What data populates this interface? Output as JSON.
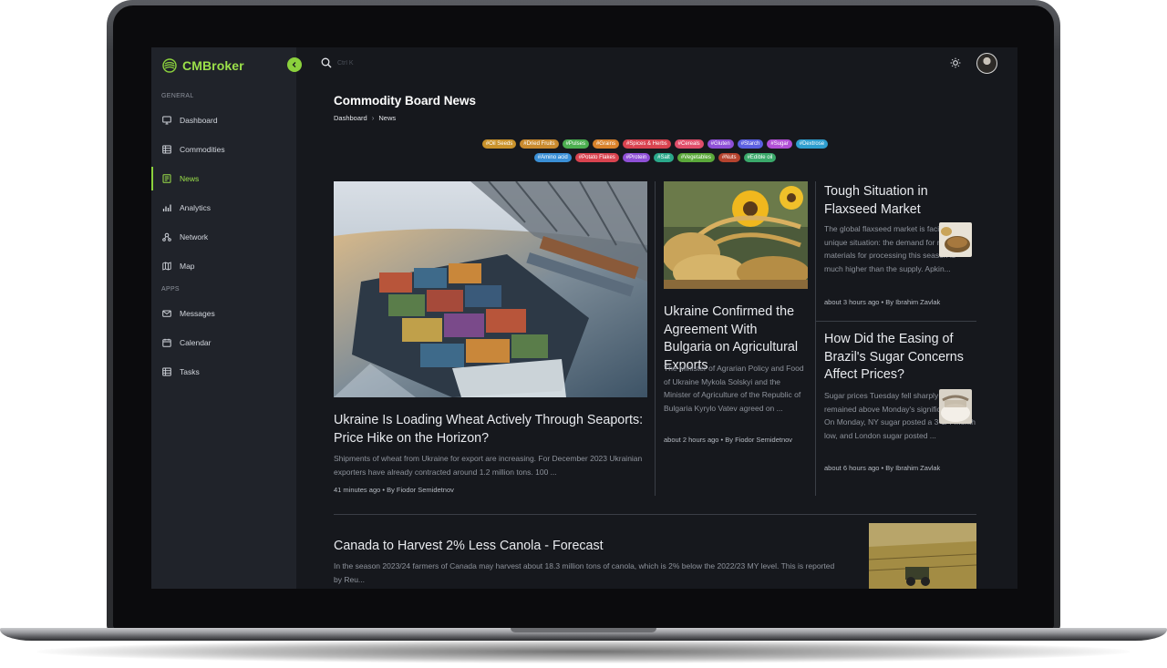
{
  "app": {
    "brand": "CMBroker"
  },
  "sidebar": {
    "sections": [
      {
        "label": "GENERAL"
      },
      {
        "label": "APPS"
      }
    ],
    "items": [
      {
        "label": "Dashboard",
        "icon": "monitor-icon"
      },
      {
        "label": "Commodities",
        "icon": "table-icon"
      },
      {
        "label": "News",
        "icon": "newspaper-icon",
        "active": true
      },
      {
        "label": "Analytics",
        "icon": "bar-chart-icon"
      },
      {
        "label": "Network",
        "icon": "network-icon"
      },
      {
        "label": "Map",
        "icon": "map-icon"
      },
      {
        "label": "Messages",
        "icon": "mail-icon"
      },
      {
        "label": "Calendar",
        "icon": "calendar-icon"
      },
      {
        "label": "Tasks",
        "icon": "tasks-icon"
      }
    ]
  },
  "search": {
    "placeholder": "Ctrl K"
  },
  "header": {
    "title": "Commodity Board News",
    "breadcrumb": [
      "Dashboard",
      "News"
    ]
  },
  "tags": {
    "row1": [
      {
        "label": "#Oil Seeds",
        "color": "#c9922b"
      },
      {
        "label": "#Dried Fruits",
        "color": "#c98a2e"
      },
      {
        "label": "#Pulses",
        "color": "#4caf50"
      },
      {
        "label": "#Grains",
        "color": "#d9822b"
      },
      {
        "label": "#Spices & Herbs",
        "color": "#d9434f"
      },
      {
        "label": "#Cereals",
        "color": "#e04e6a"
      },
      {
        "label": "#Gluten",
        "color": "#8e4fd6"
      },
      {
        "label": "#Starch",
        "color": "#5b5fe0"
      },
      {
        "label": "#Sugar",
        "color": "#b14fd6"
      },
      {
        "label": "#Dextrose",
        "color": "#2f9ecf"
      }
    ],
    "row2": [
      {
        "label": "#Amino acid",
        "color": "#3a8fd6"
      },
      {
        "label": "#Potato Flakes",
        "color": "#d9434f"
      },
      {
        "label": "#Protein",
        "color": "#8e4fd6"
      },
      {
        "label": "#Salt",
        "color": "#2aa88a"
      },
      {
        "label": "#Vegetables",
        "color": "#5aa83a"
      },
      {
        "label": "#Nuts",
        "color": "#b5432e"
      },
      {
        "label": "#Edible oil",
        "color": "#3aa86a"
      }
    ]
  },
  "articles": {
    "main": {
      "title": "Ukraine Is Loading Wheat Actively Through Seaports: Price Hike on the Horizon?",
      "excerpt": "Shipments of wheat from Ukraine for export are increasing. For December 2023 Ukrainian exporters have already contracted around 1.2 million tons. 100 ...",
      "meta": "41 minutes ago • By Fiodor Semidetnov"
    },
    "middle": {
      "title": "Ukraine Confirmed the Agreement With Bulgaria on Agricultural Exports",
      "excerpt": "The Minister of Agrarian Policy and Food of Ukraine Mykola Solskyi and the Minister of Agriculture of the Republic of Bulgaria Kyrylo Vatev agreed on ...",
      "meta": "about 2 hours ago • By Fiodor Semidetnov"
    },
    "side1": {
      "title": "Tough Situation in Flaxseed Market",
      "excerpt": "The global flaxseed market is facing a unique situation: the demand for raw materials for processing this season is much higher than the supply. Apkin...",
      "meta": "about 3 hours ago • By Ibrahim Zavlak"
    },
    "side2": {
      "title": "How Did the Easing of Brazil's Sugar Concerns Affect Prices?",
      "excerpt": "Sugar prices Tuesday fell sharply but remained above Monday's significant lows. On Monday, NY sugar posted a 3-1/4 month low, and London sugar posted ...",
      "meta": "about 6 hours ago • By Ibrahim Zavlak"
    },
    "bottom": {
      "title": "Canada to Harvest 2% Less Canola - Forecast",
      "excerpt": "In the season 2023/24 farmers of Canada may harvest about 18.3 million tons of canola, which is 2% below the 2022/23 MY level. This is reported by Reu..."
    }
  },
  "colors": {
    "accent": "#8bd13d",
    "sidebar_bg": "#20232a",
    "content_bg": "#16181d"
  }
}
